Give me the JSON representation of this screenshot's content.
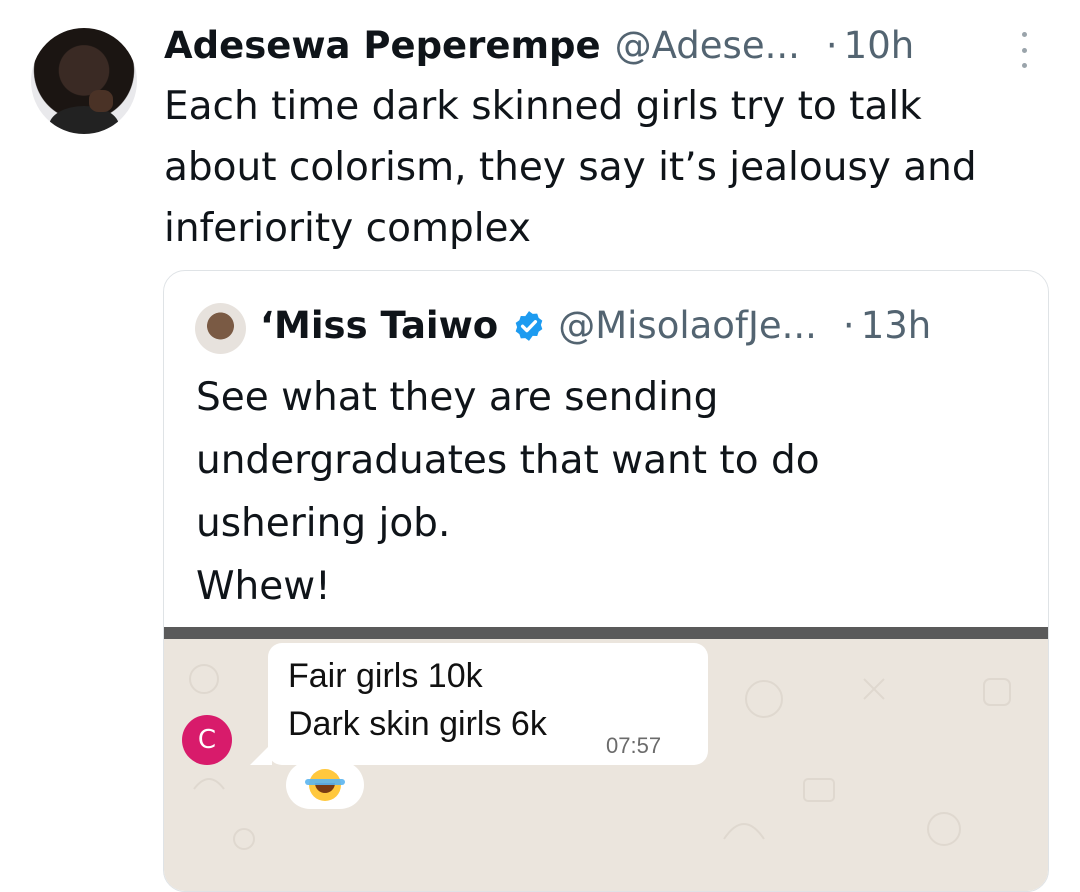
{
  "tweet": {
    "author_name": "Adesewa Peperempe",
    "author_handle": "@Adese...",
    "separator": "·",
    "time": "10h",
    "text": "Each time dark skinned girls try to talk about colorism, they say it’s jealousy and inferiority complex"
  },
  "quoted_tweet": {
    "author_name": "‘Miss Taiwo",
    "author_handle": "@MisolaofJe...",
    "separator": "·",
    "time": "13h",
    "text": "See what they are sending\nundergraduates that want to do\nushering job.\nWhew!",
    "media": {
      "avatar_letter": "C",
      "message_line1": "Fair girls 10k",
      "message_line2": "Dark skin girls 6k",
      "message_time": "07:57",
      "reaction_icon": "laughing-with-tears-emoji"
    }
  },
  "colors": {
    "text": "#0f1419",
    "secondary": "#536471",
    "verified": "#1d9bf0",
    "chat_avatar": "#d81b6b",
    "chat_background": "#ebe5dd"
  }
}
